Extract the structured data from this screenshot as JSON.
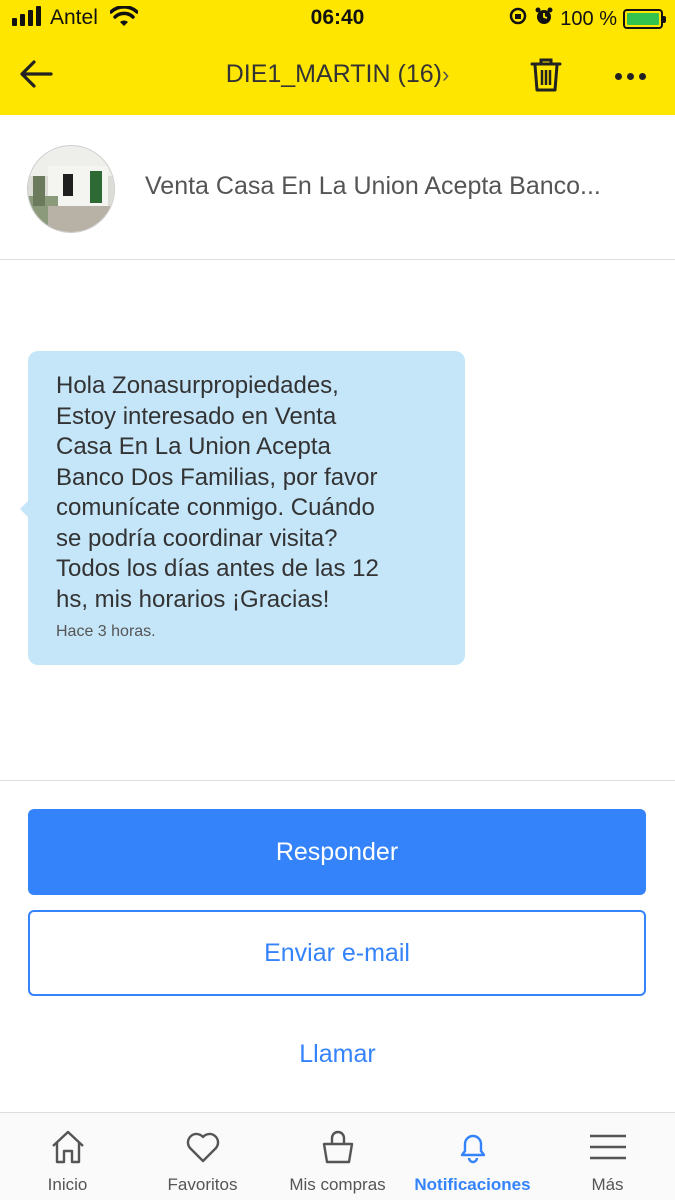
{
  "status_bar": {
    "carrier": "Antel",
    "time": "06:40",
    "battery": "100 %"
  },
  "header": {
    "title": "DIE1_MARTIN (16)",
    "title_chevron": "›"
  },
  "listing": {
    "title": "Venta Casa En La Union Acepta Banco..."
  },
  "message": {
    "lines": [
      "Hola Zonasurpropiedades,",
      "Estoy interesado en Venta",
      "Casa En La Union Acepta",
      "Banco Dos Familias, por favor",
      "comunícate conmigo. Cuándo",
      "se podría coordinar visita?",
      "Todos los días antes de las 12",
      "hs, mis horarios ¡Gracias!"
    ],
    "time": "Hace 3 horas."
  },
  "actions": {
    "reply": "Responder",
    "email": "Enviar e-mail",
    "call": "Llamar"
  },
  "tabbar": {
    "items": [
      {
        "label": "Inicio",
        "icon": "home-icon"
      },
      {
        "label": "Favoritos",
        "icon": "heart-icon"
      },
      {
        "label": "Mis compras",
        "icon": "shopping-bag-icon"
      },
      {
        "label": "Notificaciones",
        "icon": "bell-icon"
      },
      {
        "label": "Más",
        "icon": "menu-icon"
      }
    ],
    "active_index": 3
  },
  "colors": {
    "header_bg": "#ffe600",
    "primary": "#3483fa",
    "bubble_bg": "#c5e5f8"
  }
}
